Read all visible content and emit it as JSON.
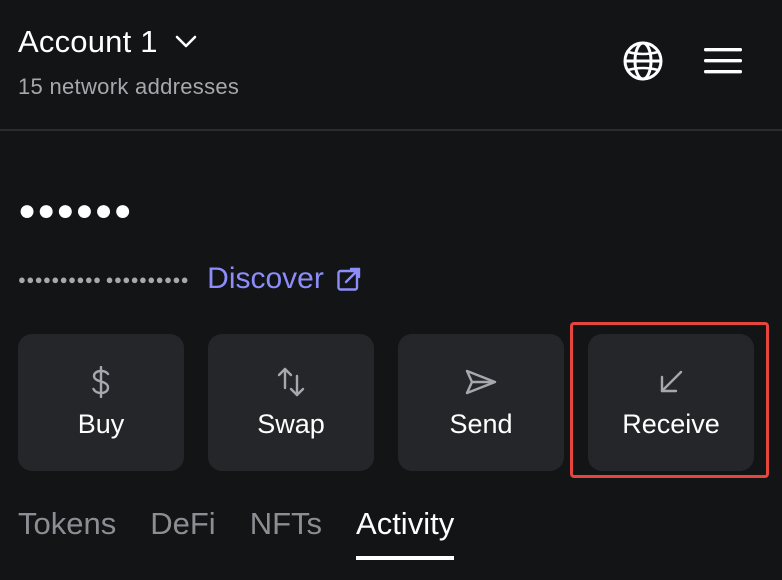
{
  "header": {
    "account_name": "Account 1",
    "network_addresses": "15 network addresses",
    "icons": [
      "chevron-down-icon",
      "globe-icon",
      "menu-icon"
    ]
  },
  "balance": {
    "masked_value": "●●●●●●",
    "masked_change": "●●●●●●●●●● ●●●●●●●●●●"
  },
  "discover": {
    "label": "Discover",
    "icon": "external-link-icon",
    "color": "#8c8df8"
  },
  "actions": [
    {
      "label": "Buy",
      "icon": "dollar-icon"
    },
    {
      "label": "Swap",
      "icon": "swap-icon"
    },
    {
      "label": "Send",
      "icon": "send-icon"
    },
    {
      "label": "Receive",
      "icon": "receive-icon"
    }
  ],
  "highlight": {
    "target": "Receive",
    "color": "#e5453c"
  },
  "tabs": [
    {
      "label": "Tokens",
      "active": false
    },
    {
      "label": "DeFi",
      "active": false
    },
    {
      "label": "NFTs",
      "active": false
    },
    {
      "label": "Activity",
      "active": true
    }
  ],
  "colors": {
    "background": "#131416",
    "card": "#25262a",
    "accent": "#8c8df8",
    "muted": "#a7a8ad"
  }
}
